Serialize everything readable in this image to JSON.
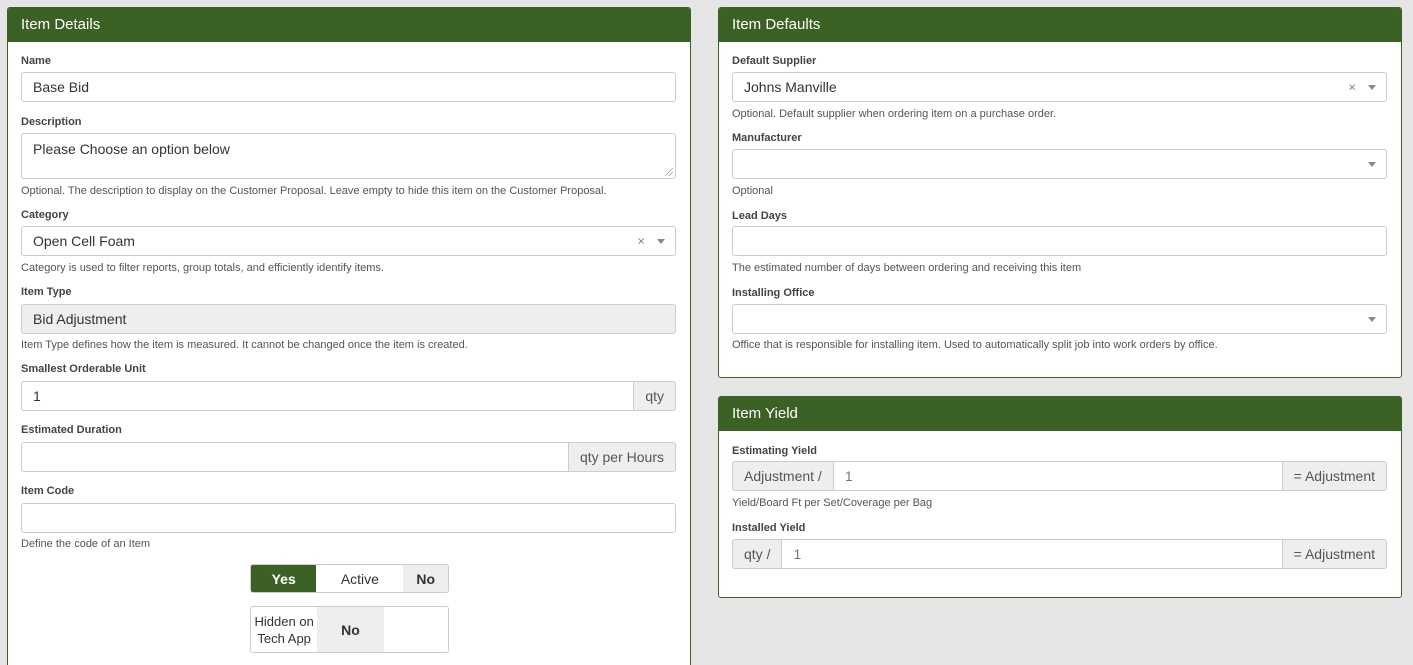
{
  "item_details": {
    "title": "Item Details",
    "name": {
      "label": "Name",
      "value": "Base Bid"
    },
    "description": {
      "label": "Description",
      "value": "Please Choose an option below",
      "help": "Optional. The description to display on the Customer Proposal. Leave empty to hide this item on the Customer Proposal."
    },
    "category": {
      "label": "Category",
      "value": "Open Cell Foam",
      "clear": "×",
      "help": "Category is used to filter reports, group totals, and efficiently identify items."
    },
    "item_type": {
      "label": "Item Type",
      "value": "Bid Adjustment",
      "help": "Item Type defines how the item is measured. It cannot be changed once the item is created."
    },
    "smallest_unit": {
      "label": "Smallest Orderable Unit",
      "value": "1",
      "addon": "qty"
    },
    "estimated_duration": {
      "label": "Estimated Duration",
      "value": "",
      "addon": "qty per Hours"
    },
    "item_code": {
      "label": "Item Code",
      "value": "",
      "help": "Define the code of an Item"
    },
    "active_toggle": {
      "on": "Yes",
      "middle": "Active",
      "off": "No"
    },
    "hidden_toggle": {
      "middle": "Hidden on Tech App",
      "off": "No"
    }
  },
  "item_defaults": {
    "title": "Item Defaults",
    "default_supplier": {
      "label": "Default Supplier",
      "value": "Johns Manville",
      "clear": "×",
      "help": "Optional. Default supplier when ordering item on a purchase order."
    },
    "manufacturer": {
      "label": "Manufacturer",
      "value": "",
      "help": "Optional"
    },
    "lead_days": {
      "label": "Lead Days",
      "value": "",
      "help": "The estimated number of days between ordering and receiving this item"
    },
    "installing_office": {
      "label": "Installing Office",
      "value": "",
      "help": "Office that is responsible for installing item. Used to automatically split job into work orders by office."
    }
  },
  "item_yield": {
    "title": "Item Yield",
    "estimating_yield": {
      "label": "Estimating Yield",
      "prefix": "Adjustment /",
      "value": "1",
      "suffix": "= Adjustment",
      "help": "Yield/Board Ft per Set/Coverage per Bag"
    },
    "installed_yield": {
      "label": "Installed Yield",
      "prefix": "qty /",
      "value": "1",
      "suffix": "= Adjustment"
    }
  }
}
